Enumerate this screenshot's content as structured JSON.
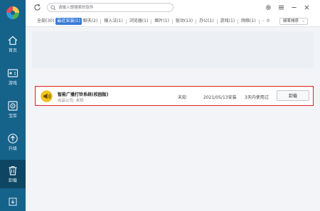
{
  "sidebar": {
    "items": [
      {
        "label": "首页",
        "icon": "home-icon"
      },
      {
        "label": "游戏",
        "icon": "gamepad-icon"
      },
      {
        "label": "宝库",
        "icon": "vault-icon"
      },
      {
        "label": "升级",
        "icon": "upgrade-icon"
      },
      {
        "label": "卸载",
        "icon": "trash-icon",
        "active": true
      }
    ],
    "bottom_icon": "download-icon"
  },
  "search": {
    "placeholder": "请输入想搜索的软件"
  },
  "filters": [
    {
      "label": "全部(30)"
    },
    {
      "label": "最近安装(1)",
      "active": true
    },
    {
      "label": "聊天(2)"
    },
    {
      "label": "输入法(1)"
    },
    {
      "label": "浏览器(1)"
    },
    {
      "label": "图片(1)"
    },
    {
      "label": "驱动(13)"
    },
    {
      "label": "办公(1)"
    },
    {
      "label": "游戏(1)"
    },
    {
      "label": "网络(1)"
    },
    {
      "label": "0"
    }
  ],
  "sort": {
    "selected": "频率排序"
  },
  "apps": [
    {
      "name": "智能广播打铃系统(校园版)",
      "publisher": "出品公司: 未知",
      "version": "未知",
      "install_date": "2021/05/13安装",
      "usage": "3天内使用过",
      "action": "卸载"
    }
  ],
  "colors": {
    "sidebar": "#15628a",
    "sidebar_active": "#0e4563",
    "accent": "#3a7bd5",
    "highlight": "#e02020"
  }
}
